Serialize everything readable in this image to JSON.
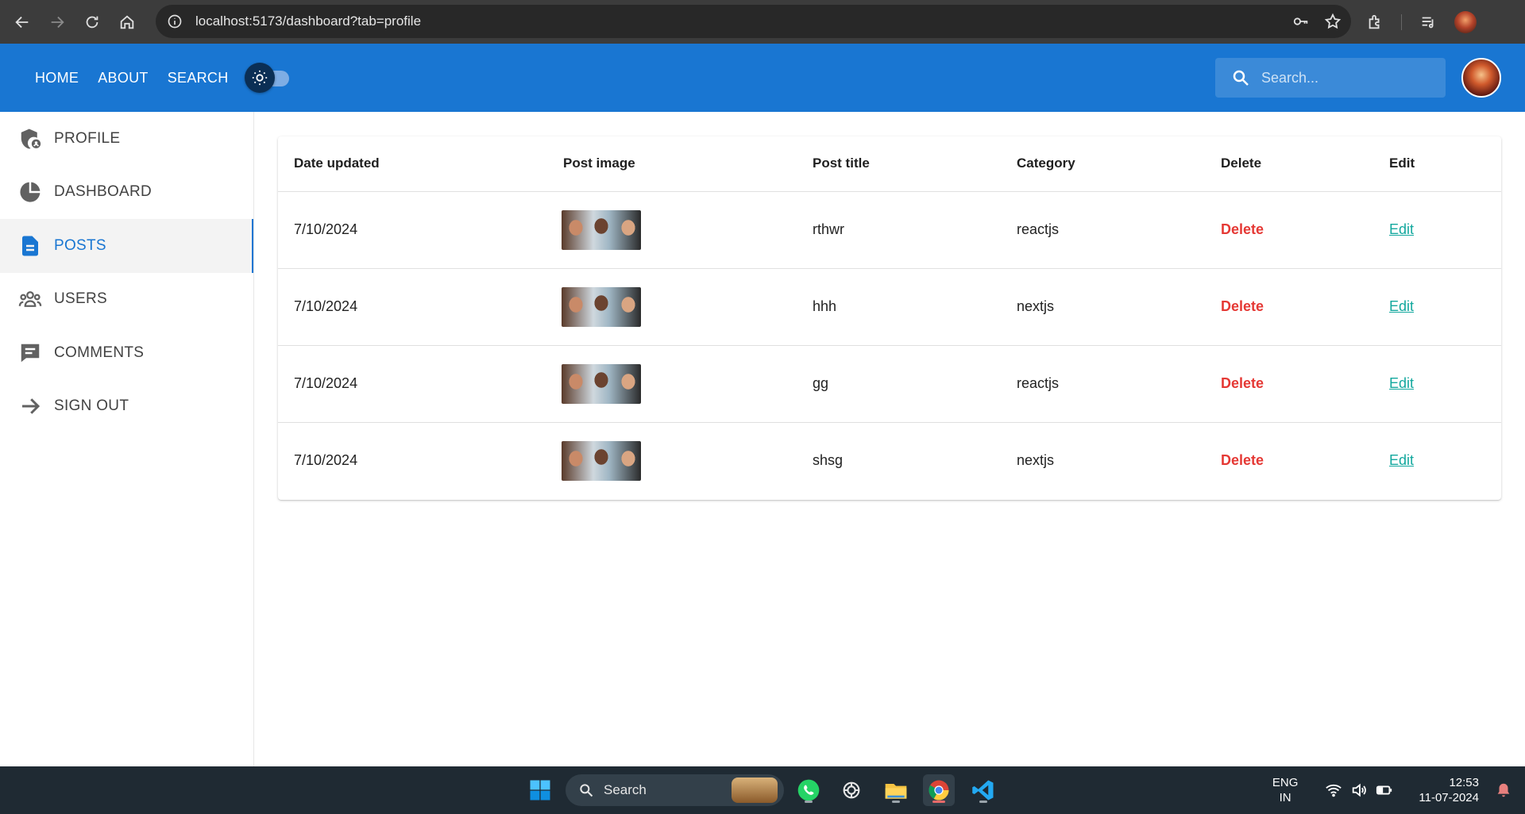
{
  "browser": {
    "url": "localhost:5173/dashboard?tab=profile"
  },
  "header": {
    "nav": [
      "HOME",
      "ABOUT",
      "SEARCH"
    ],
    "search_placeholder": "Search..."
  },
  "sidebar": {
    "items": [
      {
        "label": "PROFILE",
        "icon": "admin-shield-icon",
        "active": false
      },
      {
        "label": "DASHBOARD",
        "icon": "pie-chart-icon",
        "active": false
      },
      {
        "label": "POSTS",
        "icon": "document-icon",
        "active": true
      },
      {
        "label": "USERS",
        "icon": "group-icon",
        "active": false
      },
      {
        "label": "COMMENTS",
        "icon": "comment-icon",
        "active": false
      },
      {
        "label": "SIGN OUT",
        "icon": "arrow-right-icon",
        "active": false
      }
    ]
  },
  "table": {
    "headers": [
      "Date updated",
      "Post image",
      "Post title",
      "Category",
      "Delete",
      "Edit"
    ],
    "rows": [
      {
        "date": "7/10/2024",
        "title": "rthwr",
        "category": "reactjs",
        "delete": "Delete",
        "edit": "Edit"
      },
      {
        "date": "7/10/2024",
        "title": "hhh",
        "category": "nextjs",
        "delete": "Delete",
        "edit": "Edit"
      },
      {
        "date": "7/10/2024",
        "title": "gg",
        "category": "reactjs",
        "delete": "Delete",
        "edit": "Edit"
      },
      {
        "date": "7/10/2024",
        "title": "shsg",
        "category": "nextjs",
        "delete": "Delete",
        "edit": "Edit"
      }
    ]
  },
  "taskbar": {
    "search_label": "Search",
    "language": [
      "ENG",
      "IN"
    ],
    "time": "12:53",
    "date": "11-07-2024"
  },
  "colors": {
    "primary": "#1976d2",
    "delete": "#e53935",
    "edit": "#13a89e",
    "browser_chrome": "#3c3c3c",
    "taskbar": "#1f2a33"
  }
}
